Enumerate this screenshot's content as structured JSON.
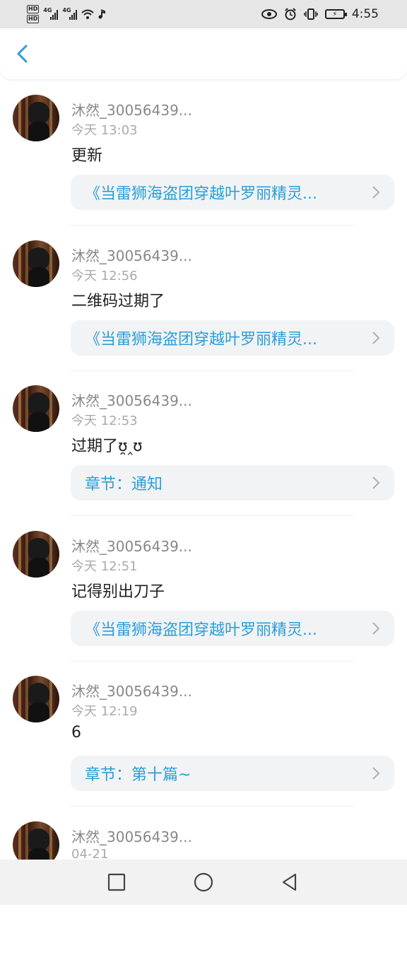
{
  "status_bar": {
    "hd1": "HD",
    "hd2": "HD",
    "net1": "4G",
    "net2": "4G",
    "time": "4:55",
    "icons": [
      "eye-icon",
      "alarm-icon",
      "vibrate-icon",
      "battery-charging-icon"
    ]
  },
  "header": {
    "back_icon": "chevron-left-icon"
  },
  "comments": [
    {
      "username": "沐然_30056439...",
      "time": "今天 13:03",
      "text": "更新",
      "link": "《当雷狮海盗团穿越叶罗丽精灵..."
    },
    {
      "username": "沐然_30056439...",
      "time": "今天 12:56",
      "text": "二维码过期了",
      "link": "《当雷狮海盗团穿越叶罗丽精灵..."
    },
    {
      "username": "沐然_30056439...",
      "time": "今天 12:53",
      "text": "过期了ʊ̯‸ʊ",
      "link": "章节：通知"
    },
    {
      "username": "沐然_30056439...",
      "time": "今天 12:51",
      "text": "记得别出刀子",
      "link": "《当雷狮海盗团穿越叶罗丽精灵..."
    },
    {
      "username": "沐然_30056439...",
      "time": "今天 12:19",
      "text": "6",
      "link": "章节：第十篇~"
    },
    {
      "username": "沐然_30056439...",
      "time": "04-21",
      "text": "",
      "link": ""
    }
  ],
  "nav": {
    "icons": [
      "square-recent-icon",
      "circle-home-icon",
      "triangle-back-icon"
    ]
  },
  "colors": {
    "accent": "#2a9fd8",
    "status_bar_bg": "#e6e6e6",
    "card_bg": "#f2f3f5"
  }
}
